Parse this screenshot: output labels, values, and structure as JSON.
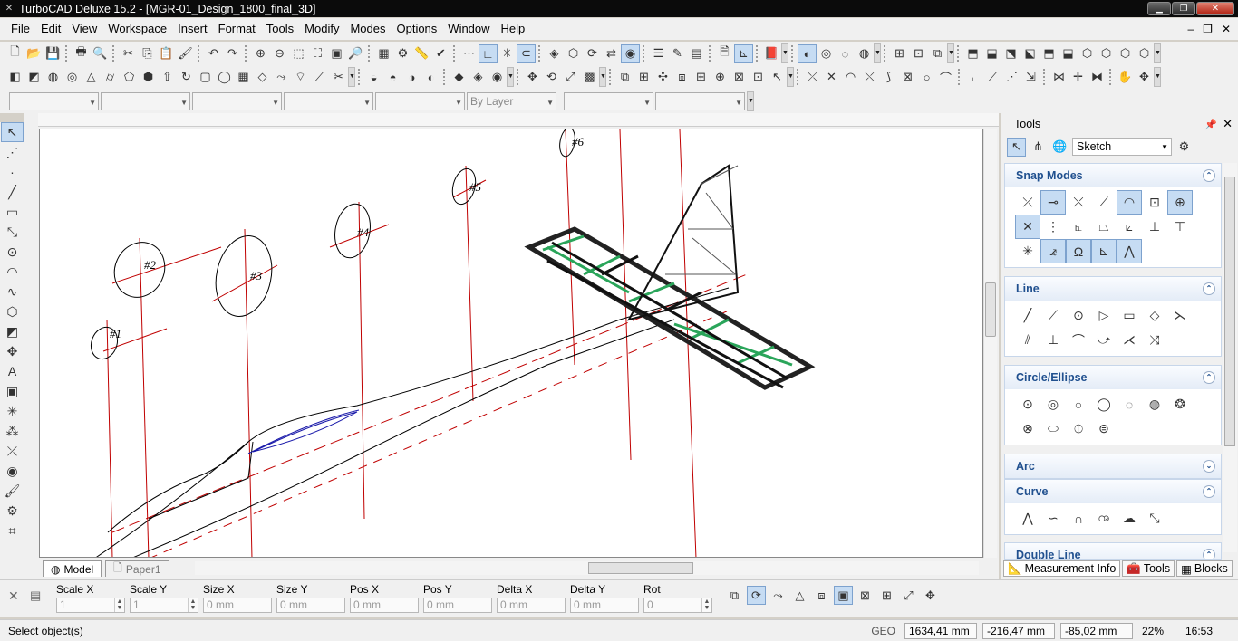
{
  "window": {
    "title": "TurboCAD Deluxe 15.2 - [MGR-01_Design_1800_final_3D]",
    "app_icon": "turbocad-icon",
    "buttons": [
      "minimize",
      "restore",
      "close"
    ]
  },
  "menubar": {
    "items": [
      {
        "label": "File"
      },
      {
        "label": "Edit"
      },
      {
        "label": "View"
      },
      {
        "label": "Workspace"
      },
      {
        "label": "Insert"
      },
      {
        "label": "Format"
      },
      {
        "label": "Tools"
      },
      {
        "label": "Modify"
      },
      {
        "label": "Modes"
      },
      {
        "label": "Options"
      },
      {
        "label": "Window"
      },
      {
        "label": "Help"
      }
    ]
  },
  "property_bar": {
    "layer_combo": "By Layer"
  },
  "drawing": {
    "labels": [
      "#1",
      "#2",
      "#3",
      "#4",
      "#5",
      "#6"
    ],
    "line_color": "#c00000",
    "rib_color": "#2aa55a"
  },
  "tabs": [
    {
      "label": "Model",
      "active": true
    },
    {
      "label": "Paper1",
      "active": false
    }
  ],
  "inspector": {
    "fields": [
      {
        "label": "Scale X",
        "value": "1"
      },
      {
        "label": "Scale Y",
        "value": "1"
      },
      {
        "label": "Size X",
        "value": "0 mm"
      },
      {
        "label": "Size Y",
        "value": "0 mm"
      },
      {
        "label": "Pos X",
        "value": "0 mm"
      },
      {
        "label": "Pos Y",
        "value": "0 mm"
      },
      {
        "label": "Delta X",
        "value": "0 mm"
      },
      {
        "label": "Delta Y",
        "value": "0 mm"
      },
      {
        "label": "Rot",
        "value": "0"
      }
    ]
  },
  "status": {
    "message": "Select object(s)",
    "geo": "GEO",
    "x": "1634,41 mm",
    "y": "-216,47 mm",
    "z": "-85,02 mm",
    "zoom": "22%",
    "time": "16:53"
  },
  "panel": {
    "title": "Tools",
    "mode": "Sketch",
    "sections": [
      {
        "title": "Snap Modes",
        "expanded": true
      },
      {
        "title": "Line",
        "expanded": true
      },
      {
        "title": "Circle/Ellipse",
        "expanded": true
      },
      {
        "title": "Arc",
        "expanded": false
      },
      {
        "title": "Curve",
        "expanded": true
      },
      {
        "title": "Double Line",
        "expanded": true
      }
    ],
    "bottom_tabs": [
      {
        "label": "Measurement Info"
      },
      {
        "label": "Tools"
      },
      {
        "label": "Blocks"
      }
    ]
  }
}
